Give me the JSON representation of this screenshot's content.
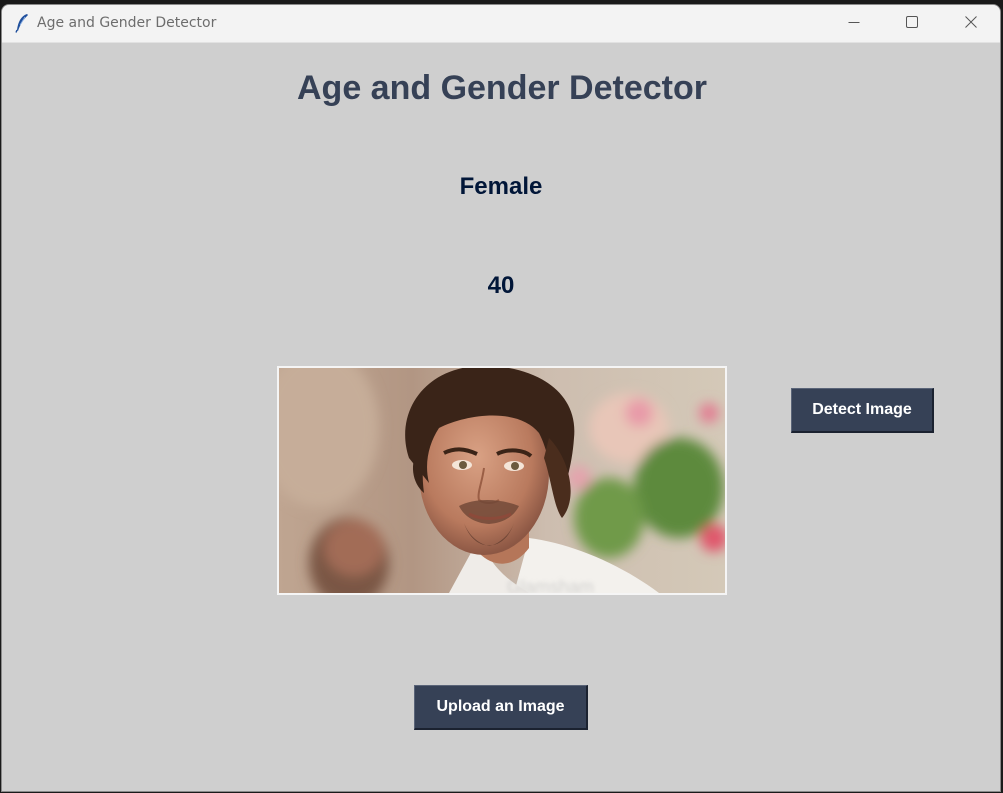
{
  "window": {
    "title": "Age and Gender Detector"
  },
  "icons": {
    "app": "feather-icon",
    "minimize": "minimize-icon",
    "maximize": "maximize-icon",
    "close": "close-icon"
  },
  "main": {
    "heading": "Age and Gender Detector",
    "gender": "Female",
    "age": "40",
    "detect_button": "Detect Image",
    "upload_button": "Upload an Image"
  },
  "colors": {
    "background": "#cfcfcf",
    "heading": "#364156",
    "result_text": "#011638",
    "button_bg": "#364156",
    "button_text": "#ffffff"
  }
}
